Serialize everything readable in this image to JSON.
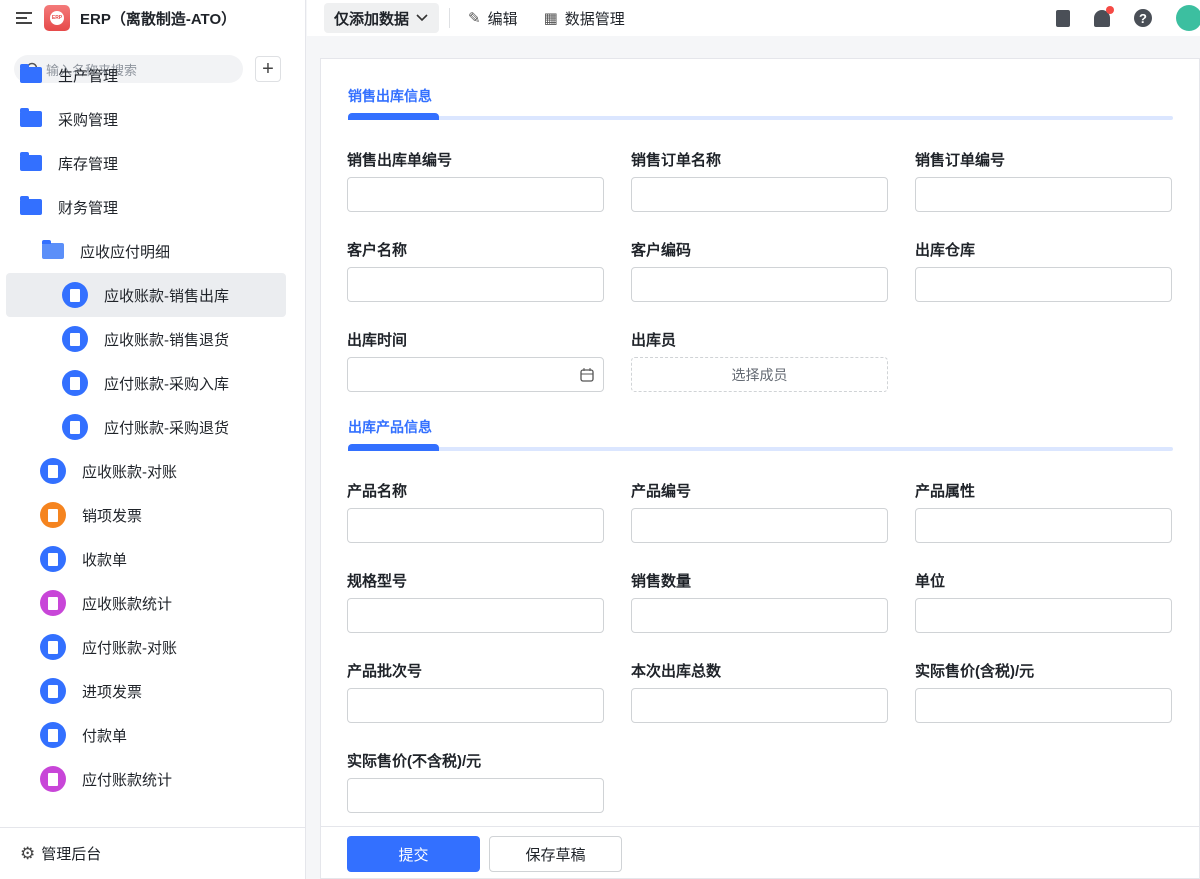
{
  "app": {
    "title": "ERP（离散制造-ATO）",
    "logo_text": "ERP"
  },
  "search": {
    "placeholder": "输入名称来搜索"
  },
  "sidebar": {
    "items": [
      {
        "label": "生产管理",
        "type": "folder"
      },
      {
        "label": "采购管理",
        "type": "folder"
      },
      {
        "label": "库存管理",
        "type": "folder"
      },
      {
        "label": "财务管理",
        "type": "folder"
      },
      {
        "label": "应收应付明细",
        "type": "folder-open"
      },
      {
        "label": "应收账款-销售出库",
        "type": "doc",
        "color": "#3370ff",
        "selected": true
      },
      {
        "label": "应收账款-销售退货",
        "type": "doc",
        "color": "#3370ff"
      },
      {
        "label": "应付账款-采购入库",
        "type": "doc",
        "color": "#3370ff"
      },
      {
        "label": "应付账款-采购退货",
        "type": "doc",
        "color": "#3370ff"
      },
      {
        "label": "应收账款-对账",
        "type": "doc",
        "color": "#3370ff"
      },
      {
        "label": "销项发票",
        "type": "doc",
        "color": "#f5841f"
      },
      {
        "label": "收款单",
        "type": "doc",
        "color": "#3370ff"
      },
      {
        "label": "应收账款统计",
        "type": "chart",
        "color": "#c846d8"
      },
      {
        "label": "应付账款-对账",
        "type": "yen",
        "color": "#3370ff"
      },
      {
        "label": "进项发票",
        "type": "wallet",
        "color": "#3370ff"
      },
      {
        "label": "付款单",
        "type": "yen",
        "color": "#3370ff"
      },
      {
        "label": "应付账款统计",
        "type": "chart",
        "color": "#c846d8"
      }
    ],
    "footer": "管理后台"
  },
  "toolbar": {
    "mode": "仅添加数据",
    "edit": "编辑",
    "data_manage": "数据管理"
  },
  "form": {
    "section1": "销售出库信息",
    "section2": "出库产品信息",
    "fields1": [
      {
        "label": "销售出库单编号",
        "value": ""
      },
      {
        "label": "销售订单名称",
        "value": ""
      },
      {
        "label": "销售订单编号",
        "value": ""
      },
      {
        "label": "客户名称",
        "value": ""
      },
      {
        "label": "客户编码",
        "value": ""
      },
      {
        "label": "出库仓库",
        "value": ""
      },
      {
        "label": "出库时间",
        "value": ""
      },
      {
        "label": "出库员",
        "value": "",
        "placeholder": "选择成员"
      }
    ],
    "fields2": [
      {
        "label": "产品名称",
        "value": ""
      },
      {
        "label": "产品编号",
        "value": ""
      },
      {
        "label": "产品属性",
        "value": ""
      },
      {
        "label": "规格型号",
        "value": ""
      },
      {
        "label": "销售数量",
        "value": ""
      },
      {
        "label": "单位",
        "value": ""
      },
      {
        "label": "产品批次号",
        "value": ""
      },
      {
        "label": "本次出库总数",
        "value": ""
      },
      {
        "label": "实际售价(含税)/元",
        "value": ""
      },
      {
        "label": "实际售价(不含税)/元",
        "value": ""
      }
    ],
    "submit": "提交",
    "save_draft": "保存草稿"
  }
}
